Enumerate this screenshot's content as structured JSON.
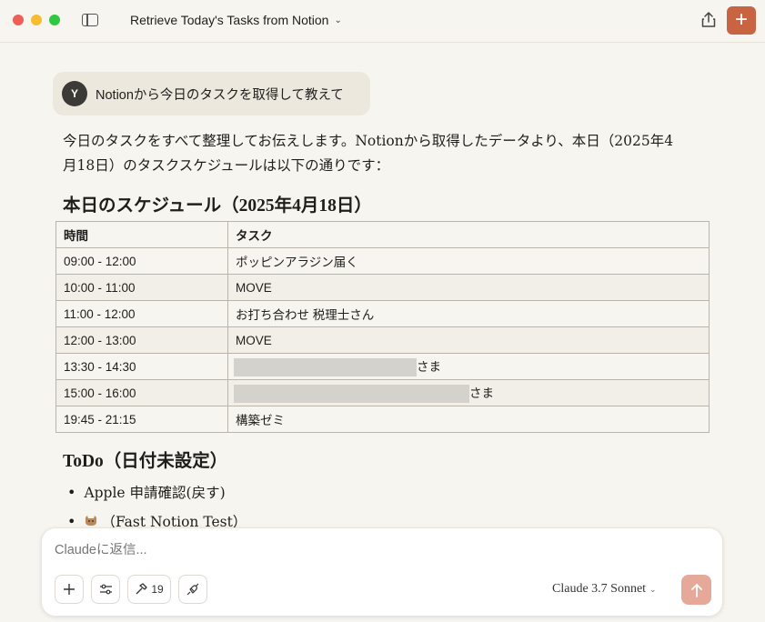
{
  "window": {
    "title": "Retrieve Today's Tasks from Notion"
  },
  "user_message": {
    "avatar_initial": "Y",
    "text": "Notionから今日のタスクを取得して教えて"
  },
  "assistant": {
    "intro": "今日のタスクをすべて整理してお伝えします。Notionから取得したデータより、本日（2025年4月18日）のタスクスケジュールは以下の通りです：",
    "schedule_heading": "本日のスケジュール（2025年4月18日）",
    "table": {
      "headers": [
        "時間",
        "タスク"
      ],
      "rows": [
        {
          "time": "09:00 - 12:00",
          "task": "ポッピンアラジン届く"
        },
        {
          "time": "10:00 - 11:00",
          "task": "MOVE"
        },
        {
          "time": "11:00 - 12:00",
          "task": "お打ち合わせ 税理士さん"
        },
        {
          "time": "12:00 - 13:00",
          "task": "MOVE"
        },
        {
          "time": "13:30 - 14:30",
          "task": "さま",
          "redacted_fraction": 0.28
        },
        {
          "time": "15:00 - 16:00",
          "task": "さま",
          "redacted_fraction": 0.36
        },
        {
          "time": "19:45 - 21:15",
          "task": "構築ゼミ"
        }
      ]
    },
    "todo_heading": "ToDo（日付未設定）",
    "todo_items": [
      {
        "text": "Apple 申請確認(戻す)"
      },
      {
        "text": "（Fast Notion Test）",
        "icon": "cat-icon"
      }
    ]
  },
  "composer": {
    "placeholder": "Claudeに返信...",
    "tools_count": "19",
    "model": "Claude 3.7 Sonnet"
  },
  "colors": {
    "accent": "#c96442",
    "send_disabled": "#e6a898",
    "background": "#f7f5f0"
  }
}
